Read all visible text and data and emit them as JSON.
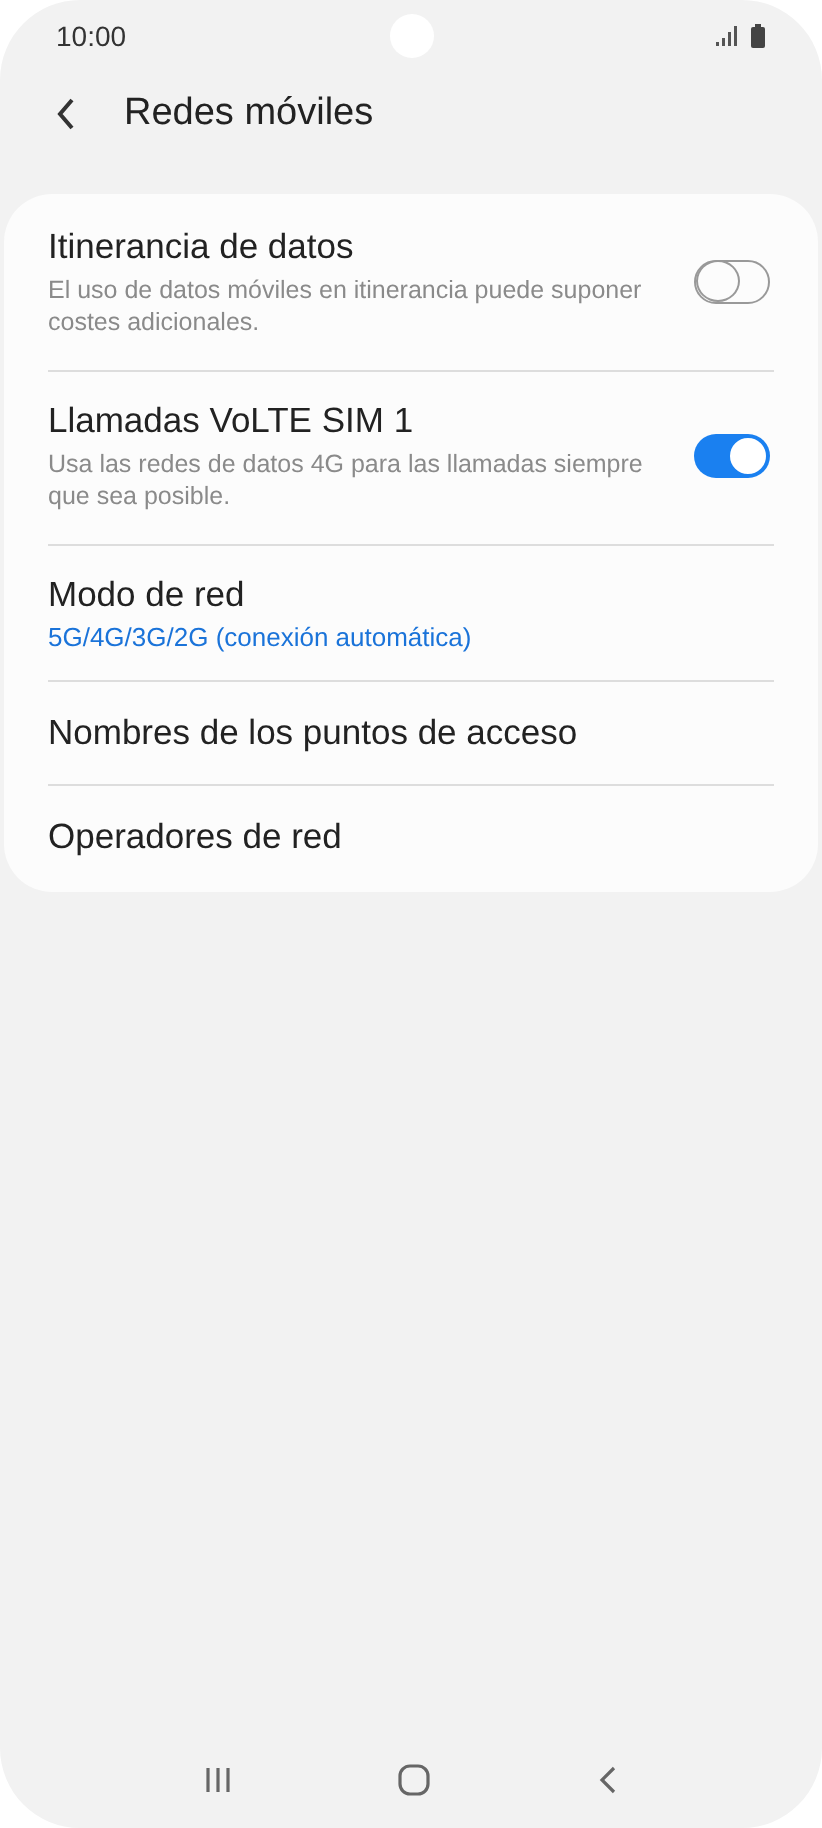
{
  "status_bar": {
    "time": "10:00"
  },
  "header": {
    "title": "Redes móviles"
  },
  "settings": [
    {
      "kind": "toggle",
      "title": "Itinerancia de datos",
      "summary": "El uso de datos móviles en itinerancia puede suponer costes adicionales.",
      "on": false
    },
    {
      "kind": "toggle",
      "title": "Llamadas VoLTE SIM 1",
      "summary": "Usa las redes de datos 4G para las llamadas siempre que sea posible.",
      "on": true
    },
    {
      "kind": "value",
      "title": "Modo de red",
      "value": "5G/4G/3G/2G (conexión automática)"
    },
    {
      "kind": "plain",
      "title": "Nombres de los puntos de acceso"
    },
    {
      "kind": "plain",
      "title": "Operadores de red"
    }
  ]
}
